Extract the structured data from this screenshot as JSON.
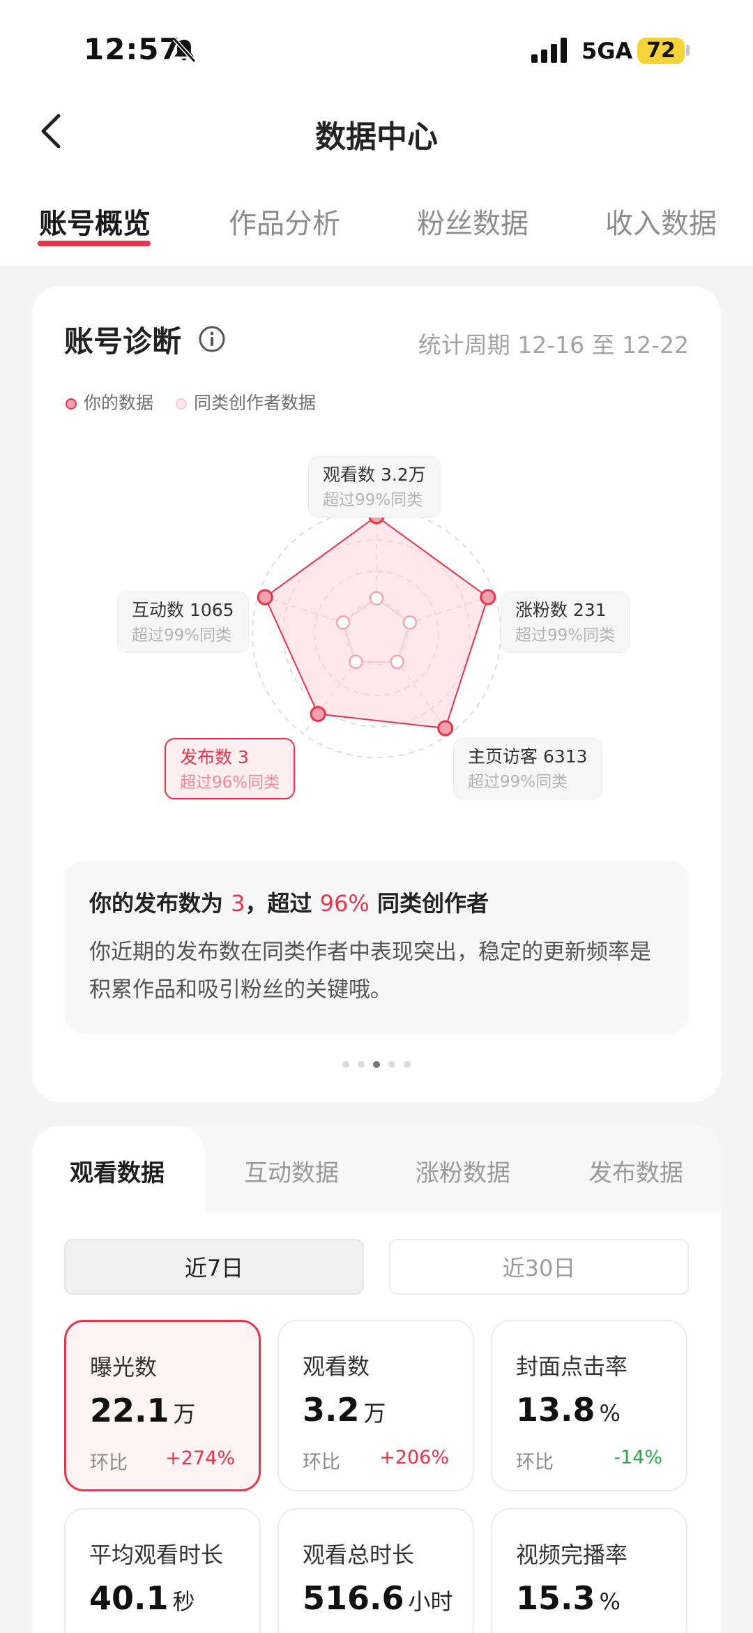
{
  "status_bar": {
    "time": "12:57",
    "network": "5GA",
    "battery": "72"
  },
  "header": {
    "title": "数据中心"
  },
  "tabs": [
    {
      "label": "账号概览",
      "active": true
    },
    {
      "label": "作品分析",
      "active": false
    },
    {
      "label": "粉丝数据",
      "active": false
    },
    {
      "label": "收入数据",
      "active": false
    }
  ],
  "diagnosis": {
    "title": "账号诊断",
    "period": "统计周期 12-16 至 12-22",
    "legend": {
      "mine": "你的数据",
      "peers": "同类创作者数据"
    },
    "colors": {
      "accent": "#e8334a",
      "mine_fill": "#fbd3d9",
      "peers_fill": "#fde9ec"
    },
    "radar": [
      {
        "label": "观看数 3.2万",
        "sub": "超过99%同类",
        "mine": 1.0,
        "peer": 0.3
      },
      {
        "label": "涨粉数 231",
        "sub": "超过99%同类",
        "mine": 1.0,
        "peer": 0.3
      },
      {
        "label": "主页访客 6313",
        "sub": "超过99%同类",
        "mine": 1.0,
        "peer": 0.3
      },
      {
        "label": "发布数 3",
        "sub": "超过96%同类",
        "mine": 0.85,
        "peer": 0.3,
        "selected": true
      },
      {
        "label": "互动数 1065",
        "sub": "超过99%同类",
        "mine": 1.0,
        "peer": 0.3
      }
    ],
    "insight": {
      "prefix": "你的发布数为 ",
      "value": "3",
      "mid": "，超过 ",
      "percent": "96%",
      "suffix": " 同类创作者",
      "body": "你近期的发布数在同类作者中表现突出，稳定的更新频率是积累作品和吸引粉丝的关键哦。"
    },
    "pager": {
      "count": 5,
      "active": 2
    }
  },
  "data_section": {
    "subtabs": [
      {
        "label": "观看数据",
        "active": true
      },
      {
        "label": "互动数据",
        "active": false
      },
      {
        "label": "涨粉数据",
        "active": false
      },
      {
        "label": "发布数据",
        "active": false
      }
    ],
    "ranges": [
      {
        "label": "近7日",
        "active": true
      },
      {
        "label": "近30日",
        "active": false
      }
    ],
    "metrics": [
      {
        "label": "曝光数",
        "value": "22.1",
        "unit": "万",
        "cmp_label": "环比",
        "delta": "+274%",
        "trend": "up",
        "selected": true
      },
      {
        "label": "观看数",
        "value": "3.2",
        "unit": "万",
        "cmp_label": "环比",
        "delta": "+206%",
        "trend": "up"
      },
      {
        "label": "封面点击率",
        "value": "13.8",
        "unit": "%",
        "cmp_label": "环比",
        "delta": "-14%",
        "trend": "down"
      },
      {
        "label": "平均观看时长",
        "value": "40.1",
        "unit": "秒"
      },
      {
        "label": "观看总时长",
        "value": "516.6",
        "unit": "小时"
      },
      {
        "label": "视频完播率",
        "value": "15.3",
        "unit": "%"
      }
    ]
  }
}
